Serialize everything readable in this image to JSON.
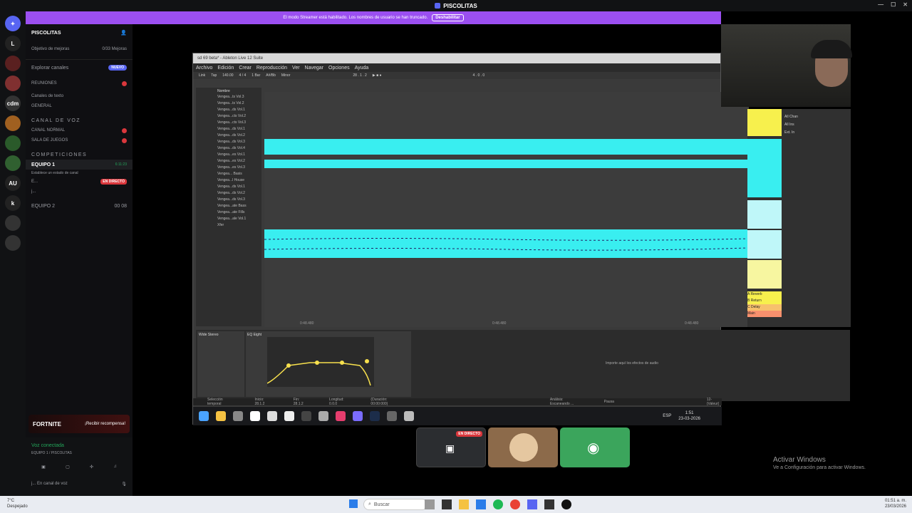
{
  "window": {
    "title": "PISCOLITAS"
  },
  "streamer_banner": {
    "text": "El modo Streamer está habilitado. Los nombres de usuario se han truncado.",
    "button": "Deshabilitar"
  },
  "guilds": [
    "L",
    "cdm",
    "AU",
    "k"
  ],
  "server": {
    "name": "PISCOLITAS",
    "boost_label": "Objetivo de mejoras",
    "boost_count": "0/33 Mejoras",
    "explore": "Explorar canales",
    "new_badge": "NUEVO",
    "reuniones": "REUNIONES",
    "text_category": "Canales de texto",
    "general": "GENERAL",
    "voice_category": "CANAL DE VOZ",
    "canal_normal": "CANAL NORMAL",
    "sala_juegos": "SALA DE JUEGOS",
    "comp_category": "COMPETICIONES",
    "equipo1": "EQUIPO 1",
    "equipo1_time": "6:11:23",
    "equipo1_status": "Establece un estado de canal",
    "member1": "E...",
    "member2": "j...",
    "live": "EN DIRECTO",
    "equipo2": "EQUIPO 2",
    "equipo2_count": "00",
    "equipo2_count2": "08"
  },
  "promo": {
    "game": "FORTNITE",
    "cta": "¡Recibir recompensa!"
  },
  "voice_panel": {
    "status": "Voz conectada",
    "channel": "EQUIPO 1 / PISCOLITAS",
    "user": "j...",
    "user_status": "En canal de voz"
  },
  "ableton": {
    "title": "sd 69 beta* - Ableton Live 12 Suite",
    "menu": [
      "Archivo",
      "Edición",
      "Crear",
      "Reproducción",
      "Ver",
      "Navegar",
      "Opciones",
      "Ayuda"
    ],
    "transport": [
      "Link",
      "Tap",
      "140.00",
      "4 / 4",
      "1 Bar",
      "A#/Bb",
      "Minor",
      "28 . 1 . 2",
      "4 . 0 . 0"
    ],
    "browser_header": "Nombre",
    "browser_items": [
      "Vengea...ts Vol.3",
      "Vengea...ts Vol.2",
      "Vengea...ds Vol.1",
      "Vengea...cts Vol.2",
      "Vengea...cts Vol.3",
      "Vengea...ds Vol.1",
      "Vengea...ds Vol.2",
      "Vengea...ds Vol.3",
      "Vengea...ds Vol.4",
      "Vengea...es Vol.1",
      "Vengea...es Vol.2",
      "Vengea...es Vol.3",
      "Vengea... Basis",
      "Vengea...l House",
      "Vengea...ds Vol.1",
      "Vengea...ds Vol.2",
      "Vengea...ds Vol.3",
      "Vengea...ate Bass",
      "Vengea...ate Fills",
      "Vengea...ale Vol.1",
      "Xfer"
    ],
    "time_markers": [
      "0:48.480",
      "0:48.480",
      "0:48.480"
    ],
    "devices": {
      "utility": "Wide Stereo",
      "eq": "EQ Eight",
      "drop_hint": "Importe aquí los efectos de audio"
    },
    "status": [
      "Selección temporal",
      "Inicio: 28.1.2",
      "Fin: 28.1.2",
      "Longitud: 0.0.0",
      "(Duración: 00:00:000)",
      "Análisis: Escaneando ...",
      "Pausa",
      "12-(Valeur)"
    ],
    "mixer_labels": [
      "All Chan",
      "All Ins",
      "Ext. In",
      "A Reverb",
      "B Return",
      "C Delay",
      "Main"
    ]
  },
  "taskbar_inner": {
    "lang": "ESP",
    "time": "1:51",
    "date": "23-03-2026"
  },
  "stream_tiles": {
    "live": "EN DIRECTO"
  },
  "activate": {
    "title": "Activar Windows",
    "subtitle": "Ve a Configuración para activar Windows."
  },
  "taskbar": {
    "weather": "7°C",
    "weather_desc": "Despejado",
    "search": "Buscar",
    "time": "01:51 a. m.",
    "date": "23/03/2026"
  },
  "colors": {
    "accent": "#5865f2",
    "banner": "#9b4ff0",
    "clip": "#39eef0",
    "live": "#da373c",
    "online": "#23a55a"
  }
}
